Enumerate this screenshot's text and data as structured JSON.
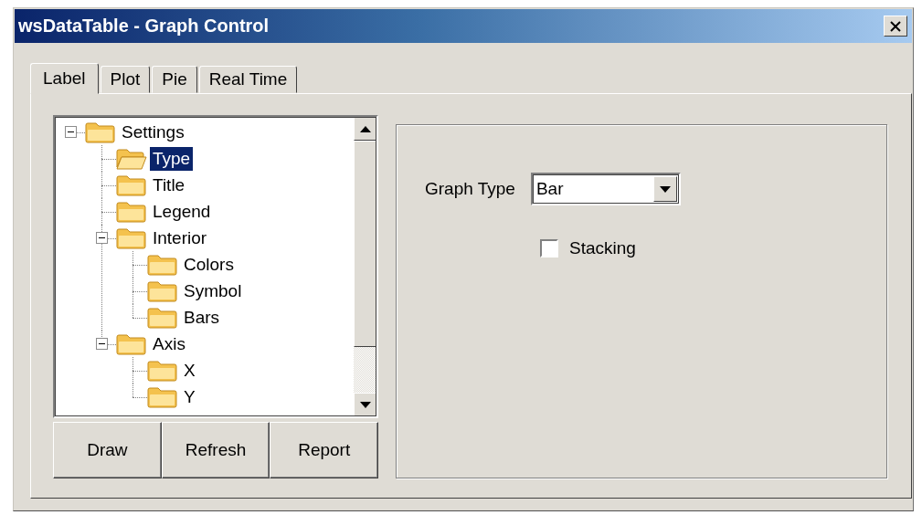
{
  "window": {
    "title": "wsDataTable - Graph Control"
  },
  "tabs": [
    {
      "label": "Label",
      "selected": true
    },
    {
      "label": "Plot",
      "selected": false
    },
    {
      "label": "Pie",
      "selected": false
    },
    {
      "label": "Real Time",
      "selected": false
    }
  ],
  "tree": {
    "items": [
      {
        "label": "Settings",
        "selected": false,
        "expanded": true,
        "children": [
          {
            "label": "Type",
            "selected": true
          },
          {
            "label": "Title",
            "selected": false
          },
          {
            "label": "Legend",
            "selected": false
          },
          {
            "label": "Interior",
            "selected": false,
            "expanded": true,
            "children": [
              {
                "label": "Colors",
                "selected": false
              },
              {
                "label": "Symbol",
                "selected": false
              },
              {
                "label": "Bars",
                "selected": false
              }
            ]
          },
          {
            "label": "Axis",
            "selected": false,
            "expanded": true,
            "children": [
              {
                "label": "X",
                "selected": false
              },
              {
                "label": "Y",
                "selected": false
              }
            ]
          }
        ]
      }
    ]
  },
  "buttons": [
    "Draw",
    "Refresh",
    "Report"
  ],
  "settings_panel": {
    "graph_type": {
      "label": "Graph Type",
      "value": "Bar"
    },
    "stacking": {
      "label": "Stacking",
      "checked": false
    }
  }
}
